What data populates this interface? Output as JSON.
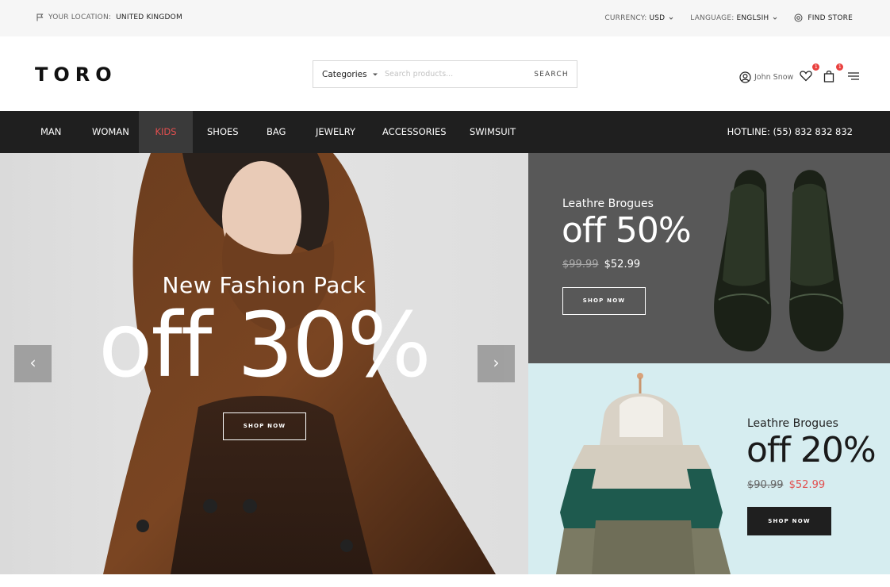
{
  "topbar": {
    "location_label": "YOUR LOCATION:",
    "location_value": "UNITED KINGDOM",
    "currency_label": "CURRENCY:",
    "currency_value": "USD",
    "language_label": "LANGUAGE:",
    "language_value": "ENGLSIH",
    "find_store": "FIND STORE"
  },
  "header": {
    "logo": "TORO",
    "search": {
      "category": "Categories",
      "placeholder": "Search products...",
      "button": "SEARCH"
    },
    "user_name": "John Snow",
    "wishlist_count": "1",
    "cart_count": "1"
  },
  "nav": {
    "items": [
      "MAN",
      "WOMAN",
      "KIDS",
      "SHOES",
      "BAG",
      "JEWELRY",
      "ACCESSORIES",
      "SWIMSUIT"
    ],
    "active": "KIDS",
    "hotline": "HOTLINE: (55) 832 832 832"
  },
  "hero": {
    "subtitle": "New Fashion Pack",
    "headline": "off 30%",
    "button": "SHOP NOW",
    "prev_arrow": "‹",
    "next_arrow": "›"
  },
  "promo1": {
    "title": "Leathre Brogues",
    "headline": "off 50%",
    "old_price": "$99.99",
    "new_price": "$52.99",
    "button": "SHOP NOW"
  },
  "promo2": {
    "title": "Leathre Brogues",
    "headline": "off 20%",
    "old_price": "$90.99",
    "new_price": "$52.99",
    "button": "SHOP NOW"
  },
  "colors": {
    "accent_red": "#e24f4f",
    "nav_bg": "#1f1f1f",
    "promo1_bg": "#585858",
    "promo2_bg": "#d6edf0"
  }
}
